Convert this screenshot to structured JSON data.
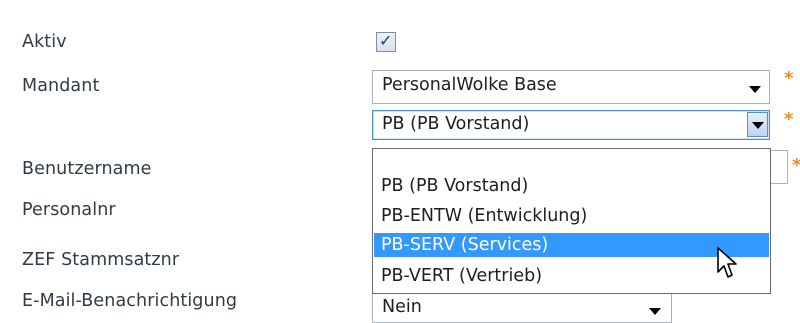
{
  "form": {
    "labels": {
      "aktiv": "Aktiv",
      "mandant": "Mandant",
      "benutzername": "Benutzername",
      "personalnr": "Personalnr",
      "zef": "ZEF Stammsatznr",
      "email": "E-Mail-Benachrichtigung"
    },
    "aktiv_checked": true,
    "aktiv_check_glyph": "✓",
    "mandant_value": "PersonalWolke Base",
    "org_value": "PB (PB Vorstand)",
    "email_value": "Nein",
    "required_marker": "*"
  },
  "dropdown": {
    "options": [
      {
        "label": "",
        "selected": false
      },
      {
        "label": "PB (PB Vorstand)",
        "selected": false
      },
      {
        "label": "PB-ENTW (Entwicklung)",
        "selected": false
      },
      {
        "label": "PB-SERV (Services)",
        "selected": true
      },
      {
        "label": "PB-VERT (Vertrieb)",
        "selected": false
      }
    ]
  },
  "colors": {
    "required": "#f08a2a",
    "selection": "#3399ff"
  },
  "icons": {
    "cursor": "mouse-pointer-icon",
    "dropdown": "chevron-down-icon"
  }
}
